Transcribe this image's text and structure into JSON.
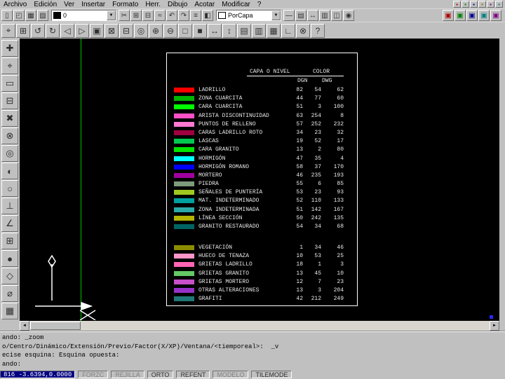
{
  "ui": {
    "dropdown_arrow": "▼"
  },
  "menubar": {
    "items": [
      {
        "name": "menu-archivo",
        "label": "Archivo"
      },
      {
        "name": "menu-edicion",
        "label": "Edición"
      },
      {
        "name": "menu-ver",
        "label": "Ver"
      },
      {
        "name": "menu-insertar",
        "label": "Insertar"
      },
      {
        "name": "menu-formato",
        "label": "Formato"
      },
      {
        "name": "menu-herr",
        "label": "Herr."
      },
      {
        "name": "menu-dibujo",
        "label": "Dibujo"
      },
      {
        "name": "menu-acotar",
        "label": "Acotar"
      },
      {
        "name": "menu-modificar",
        "label": "Modificar"
      },
      {
        "name": "menu-ayuda",
        "label": "?"
      }
    ],
    "right_icons": [
      {
        "name": "mini-red-icon",
        "glyph": "▪",
        "color": "#c00000"
      },
      {
        "name": "mini-green-icon",
        "glyph": "▪",
        "color": "#008000"
      },
      {
        "name": "mini-blue-icon",
        "glyph": "▪",
        "color": "#000090"
      },
      {
        "name": "mini-olive-icon",
        "glyph": "▪",
        "color": "#808000"
      },
      {
        "name": "mini-purple-icon",
        "glyph": "▪",
        "color": "#800080"
      },
      {
        "name": "mini-teal-icon",
        "glyph": "▪",
        "color": "#008080"
      }
    ]
  },
  "toolbar1": {
    "left_buttons": [
      {
        "name": "new-icon",
        "glyph": "▯"
      },
      {
        "name": "open-icon",
        "glyph": "◰"
      },
      {
        "name": "save-icon",
        "glyph": "▦"
      },
      {
        "name": "print-icon",
        "glyph": "▨"
      }
    ],
    "layer_combo": {
      "value": "0"
    },
    "mid_buttons": [
      {
        "name": "cut-icon",
        "glyph": "✂"
      },
      {
        "name": "copy-icon",
        "glyph": "⊞"
      },
      {
        "name": "paste-icon",
        "glyph": "⊟"
      },
      {
        "name": "match-properties-icon",
        "glyph": "≈"
      },
      {
        "name": "undo-icon",
        "glyph": "↶"
      },
      {
        "name": "redo-icon",
        "glyph": "↷"
      },
      {
        "name": "layers-icon",
        "glyph": "≡"
      },
      {
        "name": "layer-control-icon",
        "glyph": "◧"
      }
    ],
    "color_combo": {
      "value": "PorCapa"
    },
    "right_buttons": [
      {
        "name": "linetype-icon",
        "glyph": "—"
      },
      {
        "name": "properties-icon",
        "glyph": "▤"
      },
      {
        "name": "distance-icon",
        "glyph": "↔"
      },
      {
        "name": "list-icon",
        "glyph": "▥"
      },
      {
        "name": "aerial-view-icon",
        "glyph": "◫"
      },
      {
        "name": "inquiry-icon",
        "glyph": "◉"
      }
    ],
    "colored_buttons": [
      {
        "name": "red-tool-icon",
        "glyph": "▣",
        "color": "#b00000"
      },
      {
        "name": "green-tool-icon",
        "glyph": "▣",
        "color": "#008000"
      },
      {
        "name": "blue-tool-icon",
        "glyph": "▣",
        "color": "#000090"
      },
      {
        "name": "cyan-tool-icon",
        "glyph": "▣",
        "color": "#008080"
      },
      {
        "name": "magenta-tool-icon",
        "glyph": "▣",
        "color": "#800080"
      }
    ]
  },
  "toolbar2": {
    "buttons": [
      {
        "name": "select-objects-icon",
        "glyph": "⌖"
      },
      {
        "name": "group-icon",
        "glyph": "⊞"
      },
      {
        "name": "redraw-icon",
        "glyph": "↺"
      },
      {
        "name": "regen-icon",
        "glyph": "↻"
      },
      {
        "name": "view-previous-icon",
        "glyph": "◁"
      },
      {
        "name": "view-next-icon",
        "glyph": "▷"
      },
      {
        "name": "zoom-window-icon",
        "glyph": "▣"
      },
      {
        "name": "zoom-dynamic-icon",
        "glyph": "⊠"
      },
      {
        "name": "zoom-scale-icon",
        "glyph": "⊟"
      },
      {
        "name": "zoom-center-icon",
        "glyph": "◎"
      },
      {
        "name": "zoom-in-icon",
        "glyph": "⊕"
      },
      {
        "name": "zoom-out-icon",
        "glyph": "⊖"
      },
      {
        "name": "zoom-all-icon",
        "glyph": "□"
      },
      {
        "name": "zoom-extents-icon",
        "glyph": "■"
      },
      {
        "name": "pan-horizontal-icon",
        "glyph": "↔"
      },
      {
        "name": "pan-vertical-icon",
        "glyph": "↕"
      },
      {
        "name": "named-views-icon",
        "glyph": "▤"
      },
      {
        "name": "model-space-icon",
        "glyph": "▥"
      },
      {
        "name": "paper-space-icon",
        "glyph": "▦"
      },
      {
        "name": "ucs-icon",
        "glyph": "∟"
      },
      {
        "name": "osnap-settings-icon",
        "glyph": "⊗"
      },
      {
        "name": "help-icon",
        "glyph": "?"
      }
    ]
  },
  "side_toolbar": {
    "buttons": [
      {
        "name": "snap-tracking-icon",
        "glyph": "✚"
      },
      {
        "name": "snap-from-icon",
        "glyph": "⌖"
      },
      {
        "name": "snap-endpoint-icon",
        "glyph": "▭"
      },
      {
        "name": "snap-midpoint-icon",
        "glyph": "⊟"
      },
      {
        "name": "snap-intersection-icon",
        "glyph": "✖"
      },
      {
        "name": "snap-apparent-int-icon",
        "glyph": "⊗"
      },
      {
        "name": "snap-center-icon",
        "glyph": "◎"
      },
      {
        "name": "snap-quadrant-icon",
        "glyph": "◐"
      },
      {
        "name": "snap-tangent-icon",
        "glyph": "○"
      },
      {
        "name": "snap-perpendicular-icon",
        "glyph": "⊥"
      },
      {
        "name": "snap-angle-icon",
        "glyph": "∠"
      },
      {
        "name": "snap-insert-icon",
        "glyph": "⊞"
      },
      {
        "name": "snap-node-icon",
        "glyph": "●"
      },
      {
        "name": "snap-nearest-icon",
        "glyph": "◇"
      },
      {
        "name": "snap-none-icon",
        "glyph": "⌀"
      },
      {
        "name": "snap-grid-icon",
        "glyph": "▦"
      }
    ]
  },
  "canvas": {
    "bg": "#000000",
    "construction_line_color": "#00c000",
    "legend": {
      "title": "CAPA O NIVEL",
      "color_title": "COLOR",
      "col_dgn": "DGN",
      "col_dwg": "DWG",
      "group1": [
        {
          "name": "LADRILLO",
          "color": "#ff0000",
          "n1": "82",
          "n2": "54",
          "n3": "62"
        },
        {
          "name": "ZONA CUARCITA",
          "color": "#00b400",
          "n1": "44",
          "n2": "77",
          "n3": "60"
        },
        {
          "name": "CARA CUARCITA",
          "color": "#00ff00",
          "n1": "51",
          "n2": "3",
          "n3": "100"
        },
        {
          "name": "ARISTA DISCONTINUIDAD",
          "color": "#ff50c8",
          "n1": "63",
          "n2": "254",
          "n3": "8"
        },
        {
          "name": "PUNTOS DE RELLENO",
          "color": "#ff78d2",
          "n1": "57",
          "n2": "252",
          "n3": "232"
        },
        {
          "name": "CARAS LADRILLO ROTO",
          "color": "#a00040",
          "n1": "34",
          "n2": "23",
          "n3": "32"
        },
        {
          "name": "LASCAS",
          "color": "#00c850",
          "n1": "19",
          "n2": "52",
          "n3": "17"
        },
        {
          "name": "CARA GRANITO",
          "color": "#00e400",
          "n1": "13",
          "n2": "2",
          "n3": "80"
        },
        {
          "name": "HORMIGÓN",
          "color": "#00ffff",
          "n1": "47",
          "n2": "35",
          "n3": "4"
        },
        {
          "name": "HORMIGÓN ROMANO",
          "color": "#0000ff",
          "n1": "58",
          "n2": "37",
          "n3": "170"
        },
        {
          "name": "MORTERO",
          "color": "#a000a0",
          "n1": "46",
          "n2": "235",
          "n3": "193"
        },
        {
          "name": "PIEDRA",
          "color": "#7d9b7d",
          "n1": "55",
          "n2": "6",
          "n3": "85"
        },
        {
          "name": "SEÑALES DE PUNTERÍA",
          "color": "#a0c820",
          "n1": "53",
          "n2": "23",
          "n3": "93"
        },
        {
          "name": "MAT. INDETERMINADO",
          "color": "#00a0a0",
          "n1": "52",
          "n2": "110",
          "n3": "133"
        },
        {
          "name": "ZONA INDETERMINADA",
          "color": "#2aa8a8",
          "n1": "51",
          "n2": "142",
          "n3": "167"
        },
        {
          "name": "LÍNEA SECCIÓN",
          "color": "#b4b400",
          "n1": "50",
          "n2": "242",
          "n3": "135"
        },
        {
          "name": "GRANITO RESTAURADO",
          "color": "#006464",
          "n1": "54",
          "n2": "34",
          "n3": "68"
        }
      ],
      "group2": [
        {
          "name": "VEGETACIÓN",
          "color": "#8c8c00",
          "n1": "1",
          "n2": "34",
          "n3": "46"
        },
        {
          "name": "HUECO DE TENAZA",
          "color": "#ff96c8",
          "n1": "10",
          "n2": "53",
          "n3": "25"
        },
        {
          "name": "GRIETAS LADRILLO",
          "color": "#ff64b4",
          "n1": "18",
          "n2": "1",
          "n3": "3"
        },
        {
          "name": "GRIETAS GRANITO",
          "color": "#64c864",
          "n1": "13",
          "n2": "45",
          "n3": "10"
        },
        {
          "name": "GRIETAS MORTERO",
          "color": "#c850c8",
          "n1": "12",
          "n2": "7",
          "n3": "23"
        },
        {
          "name": "OTRAS ALTERACIONES",
          "color": "#9632c8",
          "n1": "13",
          "n2": "3",
          "n3": "204"
        },
        {
          "name": "GRAFITI",
          "color": "#1e7878",
          "n1": "42",
          "n2": "212",
          "n3": "249"
        }
      ]
    }
  },
  "scrollbar": {
    "left_arrow": "◄",
    "right_arrow": "►"
  },
  "command_line": {
    "lines": [
      "ando: _zoom",
      "o/Centro/Dinámico/Extensión/Previo/Factor(X/XP)/Ventana/<tiemporeal>:  _v",
      "ecise esquina: Esquina opuesta:",
      "ando:"
    ]
  },
  "statusbar": {
    "coords": "816 -3.6394,0.0000",
    "toggles": [
      {
        "name": "toggle-forzc",
        "label": "FORZC",
        "color": "#828282"
      },
      {
        "name": "toggle-rejilla",
        "label": "REJILLA",
        "color": "#828282"
      },
      {
        "name": "toggle-orto",
        "label": "ORTO",
        "color": "#303030"
      },
      {
        "name": "toggle-refent",
        "label": "REFENT",
        "color": "#303030"
      },
      {
        "name": "toggle-modelo",
        "label": "MODELO",
        "color": "#828282"
      },
      {
        "name": "toggle-tilemode",
        "label": "TILEMODE",
        "color": "#303030"
      }
    ]
  }
}
